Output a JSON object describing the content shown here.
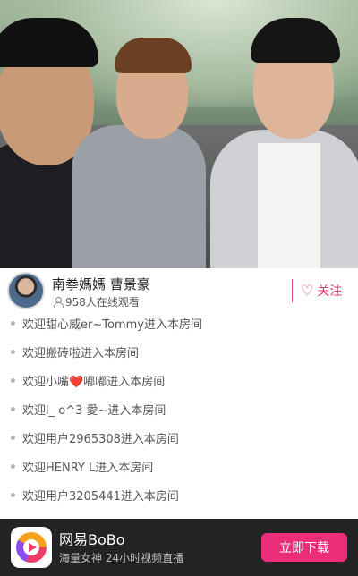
{
  "host": {
    "name": "南拳媽媽 曹景豪",
    "viewers": "958人在线观看",
    "follow_label": "关注"
  },
  "chat": {
    "messages": [
      "欢迎甜心威er~Tommy进入本房间",
      "欢迎搬砖啦进入本房间",
      "欢迎小嘴",
      "嘟嘟进入本房间",
      "欢迎l_ o^3 愛~进入本房间",
      "欢迎用户2965308进入本房间",
      "欢迎HENRY L进入本房间",
      "欢迎用户3205441进入本房间"
    ],
    "emoji": "❤️"
  },
  "banner": {
    "app_name": "网易BoBo",
    "tagline": "海量女神 24小时视频直播",
    "download_label": "立即下载"
  },
  "colors": {
    "accent": "#ec2e7a",
    "follow": "#e23c76",
    "banner_bg": "#232325"
  },
  "icons": {
    "viewer": "person-icon",
    "follow": "heart-outline-icon",
    "app": "bobo-play-icon"
  }
}
